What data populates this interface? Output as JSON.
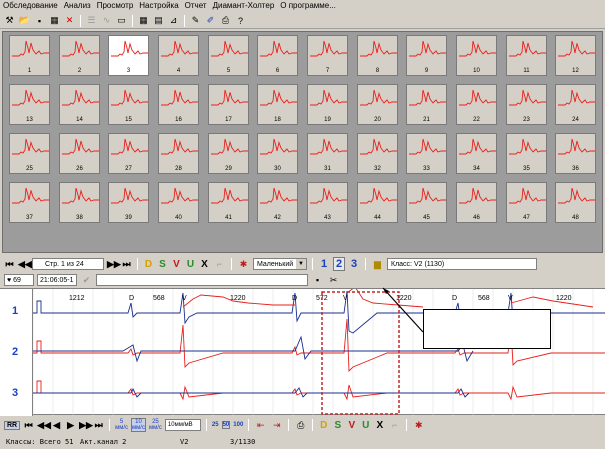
{
  "menu": [
    "Обследование",
    "Анализ",
    "Просмотр",
    "Настройка",
    "Отчет",
    "Диамант-Холтер",
    "О программе..."
  ],
  "toolbar_icons": [
    "tools-icon",
    "open-icon",
    "save-icon",
    "table-icon",
    "close-x-icon",
    "list-icon",
    "waveform-icon",
    "monitor-icon",
    "grid-icon",
    "window-icon",
    "chart-icon",
    "edit-icon",
    "pen-icon",
    "print-icon",
    "help-icon"
  ],
  "tiles": [
    "1",
    "2",
    "3",
    "4",
    "5",
    "6",
    "7",
    "8",
    "9",
    "10",
    "11",
    "12",
    "13",
    "14",
    "15",
    "16",
    "17",
    "18",
    "19",
    "20",
    "21",
    "22",
    "23",
    "24",
    "25",
    "26",
    "27",
    "28",
    "29",
    "30",
    "31",
    "32",
    "33",
    "34",
    "35",
    "36",
    "37",
    "38",
    "39",
    "40",
    "41",
    "42",
    "43",
    "44",
    "45",
    "46",
    "47",
    "48"
  ],
  "selected_tile": "3",
  "nav": {
    "page_label": "Стр. 1 из 24",
    "letters": [
      "D",
      "S",
      "V",
      "U",
      "X"
    ],
    "size_combo": "Маленький",
    "channels": [
      "1",
      "2",
      "3"
    ],
    "active_channel": "2",
    "class_label": "Класс: V2 (1130)"
  },
  "ecg_header": {
    "heart_rate": "69",
    "time": "21:06:05-1"
  },
  "ecg": {
    "channels": [
      "1",
      "2",
      "3"
    ],
    "annotations": [
      {
        "label": "1212"
      },
      {
        "label": "D"
      },
      {
        "label": "568"
      },
      {
        "label": "V"
      },
      {
        "label": "1220"
      },
      {
        "label": "D"
      },
      {
        "label": "572"
      },
      {
        "label": "V"
      },
      {
        "label": "1220"
      },
      {
        "label": "D"
      },
      {
        "label": "568"
      },
      {
        "label": "V"
      },
      {
        "label": "1220"
      }
    ]
  },
  "bottom_toolbar": {
    "rr": "RR",
    "speed": [
      "5",
      "10",
      "25"
    ],
    "speed_sub": "мм/с",
    "amp_field": "10мм/мВ",
    "scales": [
      "25",
      "50",
      "100"
    ],
    "letters": [
      "D",
      "S",
      "V",
      "U",
      "X"
    ]
  },
  "status": {
    "classes": "Классы: Всего 51",
    "act_channel": "Акт.канал 2",
    "class": "V2",
    "count": "3/1130"
  },
  "colors": {
    "ecg_red": "#e8201a",
    "ecg_blue": "#1a2e8f",
    "channel_blue": "#1a3fbf",
    "selection": "#c0282a"
  }
}
